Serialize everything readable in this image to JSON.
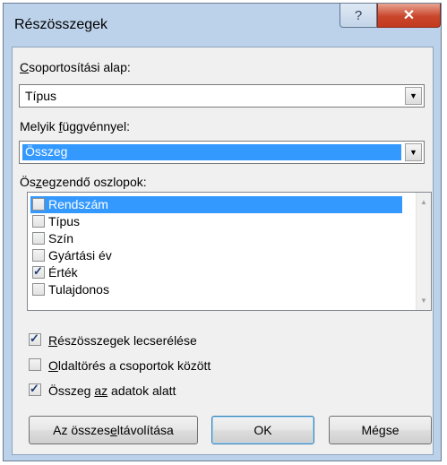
{
  "window": {
    "title": "Részösszegek",
    "help_glyph": "?",
    "close_glyph": "✕"
  },
  "group_by": {
    "label_u": "C",
    "label_rest": "soportosítási alap:",
    "value": "Típus",
    "arrow": "▼"
  },
  "function": {
    "label_pre": "Melyik ",
    "label_u": "f",
    "label_rest": "üggvénnyel:",
    "value": "Összeg",
    "arrow": "▼"
  },
  "columns": {
    "label_pre": "Ös",
    "label_u": "z",
    "label_rest": "egzendő oszlopok:",
    "items": [
      {
        "label": "Rendszám",
        "checked": false,
        "selected": true
      },
      {
        "label": "Típus",
        "checked": false,
        "selected": false
      },
      {
        "label": "Szín",
        "checked": false,
        "selected": false
      },
      {
        "label": "Gyártási év",
        "checked": false,
        "selected": false
      },
      {
        "label": "Érték",
        "checked": true,
        "selected": false
      },
      {
        "label": "Tulajdonos",
        "checked": false,
        "selected": false
      }
    ],
    "scroll_up": "▲",
    "scroll_down": "▼"
  },
  "options": {
    "replace": {
      "u": "R",
      "rest": "észösszegek lecserélése",
      "checked": true
    },
    "pagebreak": {
      "u": "O",
      "rest": "ldaltörés a csoportok között",
      "checked": false
    },
    "summary_below": {
      "pre": "Összeg ",
      "u": "az",
      "rest": " adatok alatt",
      "checked": true
    }
  },
  "buttons": {
    "remove_all_pre": "Az összes ",
    "remove_all_u": "e",
    "remove_all_rest": "ltávolítása",
    "ok": "OK",
    "cancel": "Mégse"
  }
}
